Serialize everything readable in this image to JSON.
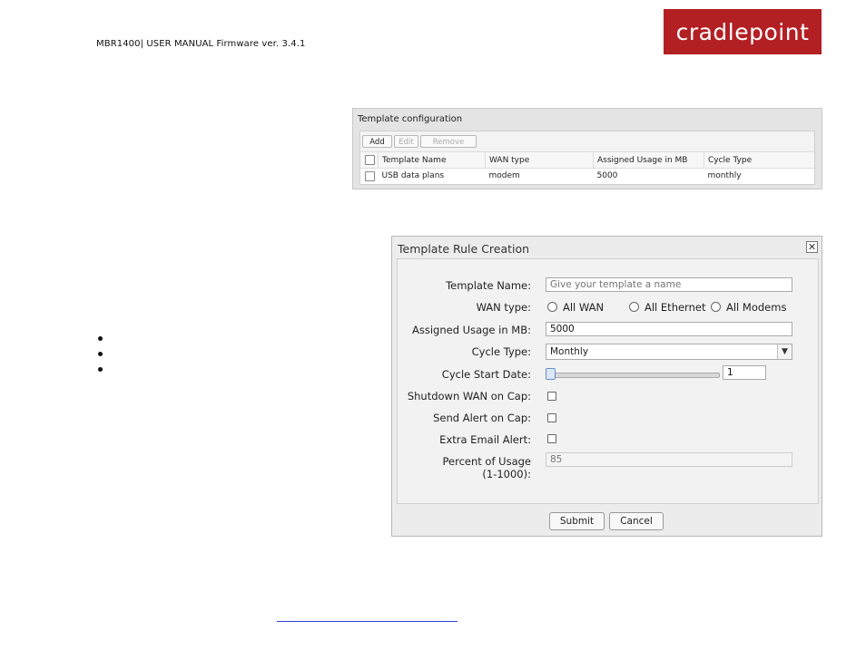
{
  "header": {
    "doc_title": "MBR1400| USER MANUAL Firmware ver. 3.4.1",
    "logo_text": "cradlepoint",
    "logo_color": "#b32024"
  },
  "template_config": {
    "title": "Template configuration",
    "buttons": {
      "add": "Add",
      "edit": "Edit",
      "remove": "Remove"
    },
    "columns": [
      "Template Name",
      "WAN type",
      "Assigned Usage in MB",
      "Cycle Type"
    ],
    "rows": [
      {
        "name": "USB data plans",
        "wan_type": "modem",
        "usage": "5000",
        "cycle": "monthly"
      }
    ]
  },
  "dialog": {
    "title": "Template Rule Creation",
    "close_glyph": "✕",
    "labels": {
      "template_name": "Template Name:",
      "wan_type": "WAN type:",
      "usage": "Assigned Usage in MB:",
      "cycle_type": "Cycle Type:",
      "cycle_start": "Cycle Start Date:",
      "shutdown": "Shutdown WAN on Cap:",
      "send_alert": "Send Alert on Cap:",
      "extra_email": "Extra Email Alert:",
      "percent_line1": "Percent of Usage",
      "percent_line2": "(1-1000):"
    },
    "template_name_placeholder": "Give your template a name",
    "wan_options": [
      "All WAN",
      "All Ethernet",
      "All Modems"
    ],
    "usage_value": "5000",
    "cycle_type_value": "Monthly",
    "cycle_start_value": "1",
    "percent_placeholder": "85",
    "submit_label": "Submit",
    "cancel_label": "Cancel"
  }
}
